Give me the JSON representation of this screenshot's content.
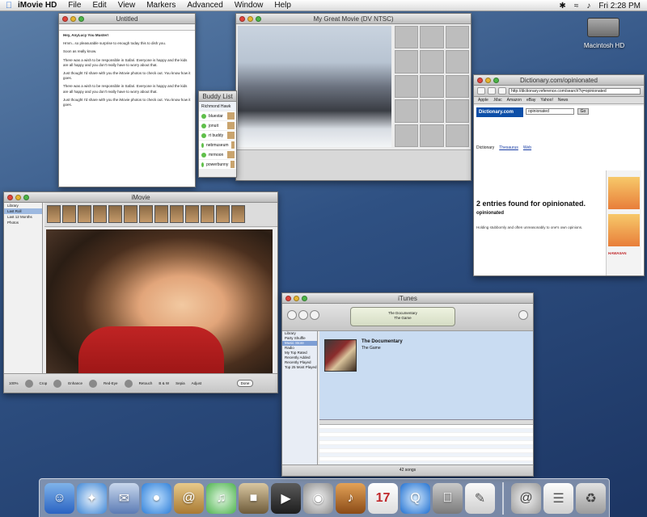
{
  "menubar": {
    "apple_icon": "apple-icon",
    "app_name": "iMovie HD",
    "menus": [
      "File",
      "Edit",
      "View",
      "Markers",
      "Advanced",
      "Window",
      "Help"
    ],
    "clock": "Fri 2:28 PM"
  },
  "desktop": {
    "hd_label": "Macintosh HD"
  },
  "textedit": {
    "title": "Untitled",
    "heading": "Hey, AnyLucy You Muster!",
    "para1": "Hmm...so pleasurable surprise to enough today this to dish you.",
    "para2": "Soon as really know.",
    "para3": "There was a wish to be responsible in Safari. Everyone is happy and the kids are all happy and you don't really have to worry about that.",
    "para4": "Just thought I'd share with you the iMovie photos to check out. You know how it goes."
  },
  "imagecapture": {
    "title": "My Great Movie (DV NTSC)"
  },
  "buddylist": {
    "title": "Buddy List",
    "header": "Richmond Hawk",
    "buddies": [
      "bluestar",
      "jonuit",
      "rt buddy",
      "nebmuseum",
      "mrmoon",
      "powerbunny"
    ]
  },
  "safari": {
    "title": "Dictionary.com/opinionated",
    "url": "http://dictionary.reference.com/search?q=opinionated",
    "bookmarks": [
      "Apple",
      ".Mac",
      "Amazon",
      "eBay",
      "Yahoo!",
      "News"
    ],
    "logo": "Dictionary.com",
    "search_value": "opinionated",
    "go_label": "Go",
    "tab_dictionary": "Dictionary",
    "tab_thesaurus": "Thesaurus",
    "tab_web": "Web",
    "entries_found": "2 entries found for opinionated.",
    "entry_word": "opinionated",
    "entry_def": "Holding stubbornly and often unreasonably to one's own opinions.",
    "ad_title": "HAWAIIAN"
  },
  "imovie": {
    "title": "iMovie",
    "sidebar": [
      "Library",
      "Last Roll",
      "Last 12 Months",
      "Photos"
    ],
    "tools": [
      "Crop",
      "Enhance",
      "Red-Eye",
      "Retouch",
      "B & W",
      "Sepia",
      "Adjust"
    ],
    "done_label": "Done",
    "zoom_label": "100%"
  },
  "itunes": {
    "title": "iTunes",
    "lcd_line1": "The Documentary",
    "lcd_line2": "The Game",
    "sources": [
      "Library",
      "Party Shuffle",
      "Music Store",
      "Radio",
      "My Top Rated",
      "Recently Added",
      "Recently Played",
      "Top 25 Most Played"
    ],
    "album_title": "The Documentary",
    "album_artist": "The Game",
    "status": "42 songs"
  },
  "dock": {
    "items": [
      "finder-icon",
      "safari-icon",
      "mail-icon",
      "ichat-icon",
      "address-book-icon",
      "itunes-icon",
      "iphoto-icon",
      "imovie-icon",
      "idvd-icon",
      "garageband-icon",
      "ical-icon",
      "quicktime-icon",
      "system-preferences-icon",
      "textedit-icon",
      "mail-server-icon",
      "trash-icon"
    ]
  },
  "colors": {
    "desktop_blue": "#2f5183",
    "accent_blue": "#0d4fa8",
    "selection": "#9db9e0"
  }
}
